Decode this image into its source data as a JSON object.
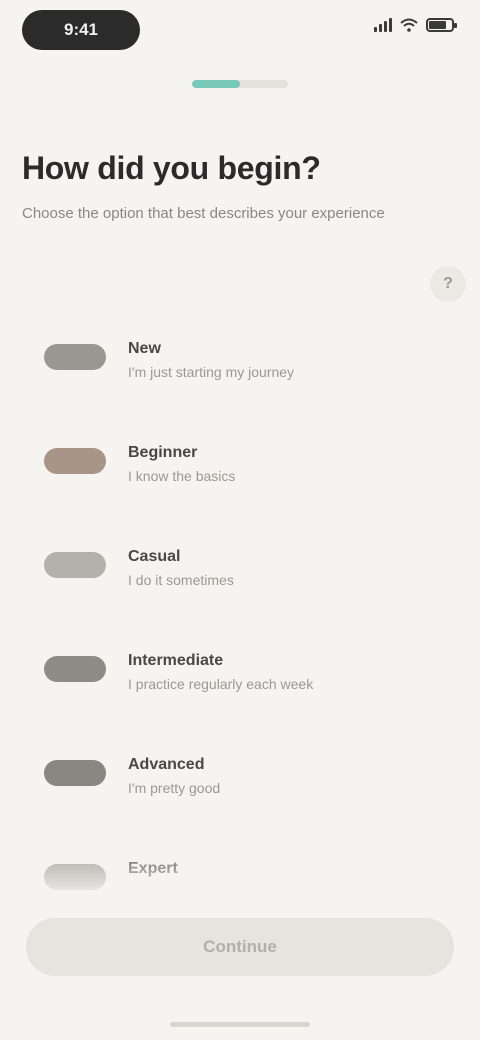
{
  "status_bar": {
    "time": "9:41",
    "battery_level": 0.8,
    "icons": [
      "signal-icon",
      "wifi-icon",
      "battery-icon"
    ]
  },
  "progress": {
    "fraction": 0.5,
    "accent_color": "#79c9b8"
  },
  "header": {
    "title": "How did you begin?",
    "subtitle": "Choose the option that best describes your experience"
  },
  "help": {
    "icon": "question-icon",
    "label": "?"
  },
  "options": [
    {
      "label": "New",
      "description": "I'm just starting my journey",
      "thumb_color": "#9a9690"
    },
    {
      "label": "Beginner",
      "description": "I know the basics",
      "thumb_color": "#a89588"
    },
    {
      "label": "Casual",
      "description": "I do it sometimes",
      "thumb_color": "#b4b1ab"
    },
    {
      "label": "Intermediate",
      "description": "I practice regularly each week",
      "thumb_color": "#8f8b85"
    },
    {
      "label": "Advanced",
      "description": "I'm pretty good",
      "thumb_color": "#8a8782"
    },
    {
      "label": "Expert",
      "description": "",
      "thumb_color": "#9c9892"
    }
  ],
  "footer": {
    "continue_label": "Continue"
  }
}
